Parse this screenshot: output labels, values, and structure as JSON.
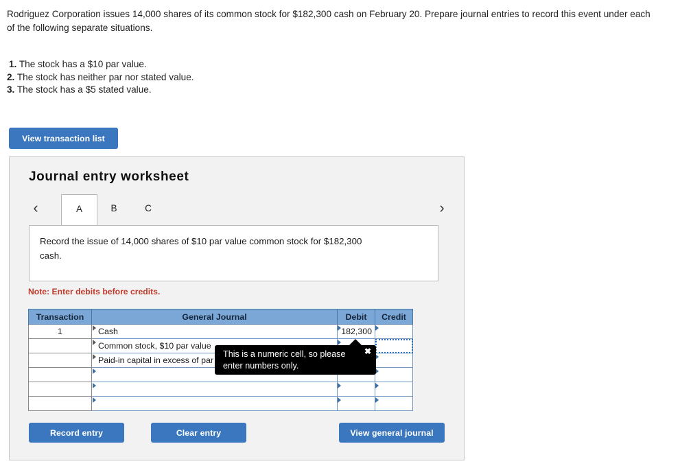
{
  "problem": {
    "prompt": "Rodriguez Corporation issues 14,000 shares of its common stock for $182,300 cash on February 20. Prepare journal entries to record this event under each of the following separate situations.",
    "requirements": [
      {
        "num": "1.",
        "text": "The stock has a $10 par value."
      },
      {
        "num": "2.",
        "text": "The stock has neither par nor stated value."
      },
      {
        "num": "3.",
        "text": "The stock has a $5 stated value."
      }
    ]
  },
  "toolbar": {
    "view_transaction_list_label": "View transaction list"
  },
  "worksheet": {
    "title": "Journal entry worksheet",
    "prev_arrow": "‹",
    "next_arrow": "›",
    "tabs": [
      {
        "label": "A",
        "active": true
      },
      {
        "label": "B",
        "active": false
      },
      {
        "label": "C",
        "active": false
      }
    ],
    "instruction": "Record the issue of 14,000 shares of $10 par value common stock for $182,300 cash.",
    "debit_note": "Note: Enter debits before credits.",
    "table": {
      "headers": [
        "Transaction",
        "General Journal",
        "Debit",
        "Credit"
      ],
      "rows": [
        {
          "transaction": "1",
          "account": "Cash",
          "debit": "182,300",
          "credit": ""
        },
        {
          "transaction": "",
          "account": "Common stock, $10 par value",
          "debit": "",
          "credit": ""
        },
        {
          "transaction": "",
          "account": "Paid-in capital in excess of par",
          "debit": "",
          "credit": ""
        },
        {
          "transaction": "",
          "account": "",
          "debit": "",
          "credit": ""
        },
        {
          "transaction": "",
          "account": "",
          "debit": "",
          "credit": ""
        },
        {
          "transaction": "",
          "account": "",
          "debit": "",
          "credit": ""
        }
      ]
    },
    "actions": {
      "record_entry_label": "Record entry",
      "clear_entry_label": "Clear entry",
      "view_general_journal_label": "View general journal"
    }
  },
  "tooltip": {
    "message": "This is a numeric cell, so please enter numbers only.",
    "close_label": "✖"
  },
  "colors": {
    "button_blue": "#3b77be",
    "table_header_blue": "#7ba7d7",
    "cell_border_blue": "#6f98c4",
    "note_red": "#c0392b",
    "panel_grey": "#f2f2f2",
    "tooltip_black": "#000000",
    "focus_outline_blue": "#2a6ebb"
  }
}
